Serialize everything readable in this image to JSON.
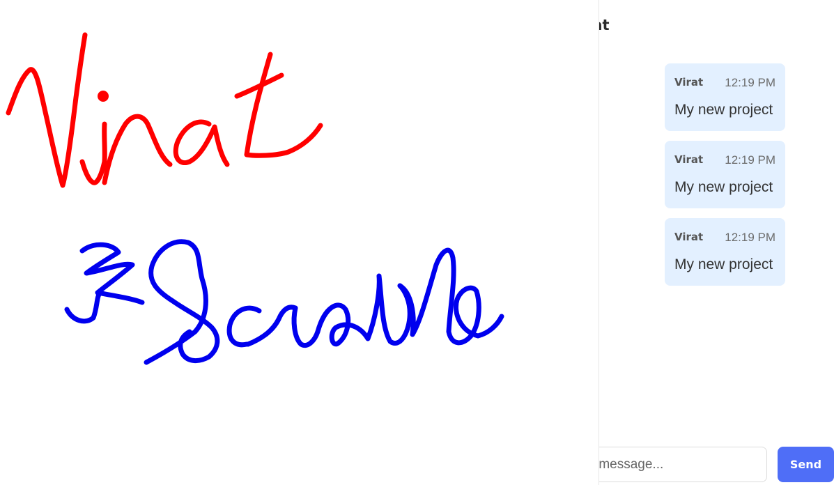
{
  "chat": {
    "title": "Chat",
    "messages": [
      {
        "author": "Virat",
        "time": "12:19 PM",
        "text": "My new project"
      },
      {
        "author": "Virat",
        "time": "12:19 PM",
        "text": "My new project"
      },
      {
        "author": "Virat",
        "time": "12:19 PM",
        "text": "My new project"
      }
    ],
    "input_placeholder": "Type a message...",
    "send_label": "Send"
  },
  "canvas": {
    "strokes": [
      {
        "word": "Virat",
        "color": "#ff0000"
      },
      {
        "word": "Scribble",
        "color": "#0000ee"
      }
    ]
  },
  "colors": {
    "message_bubble": "#e3f0ff",
    "send_button": "#4f6ef7"
  }
}
